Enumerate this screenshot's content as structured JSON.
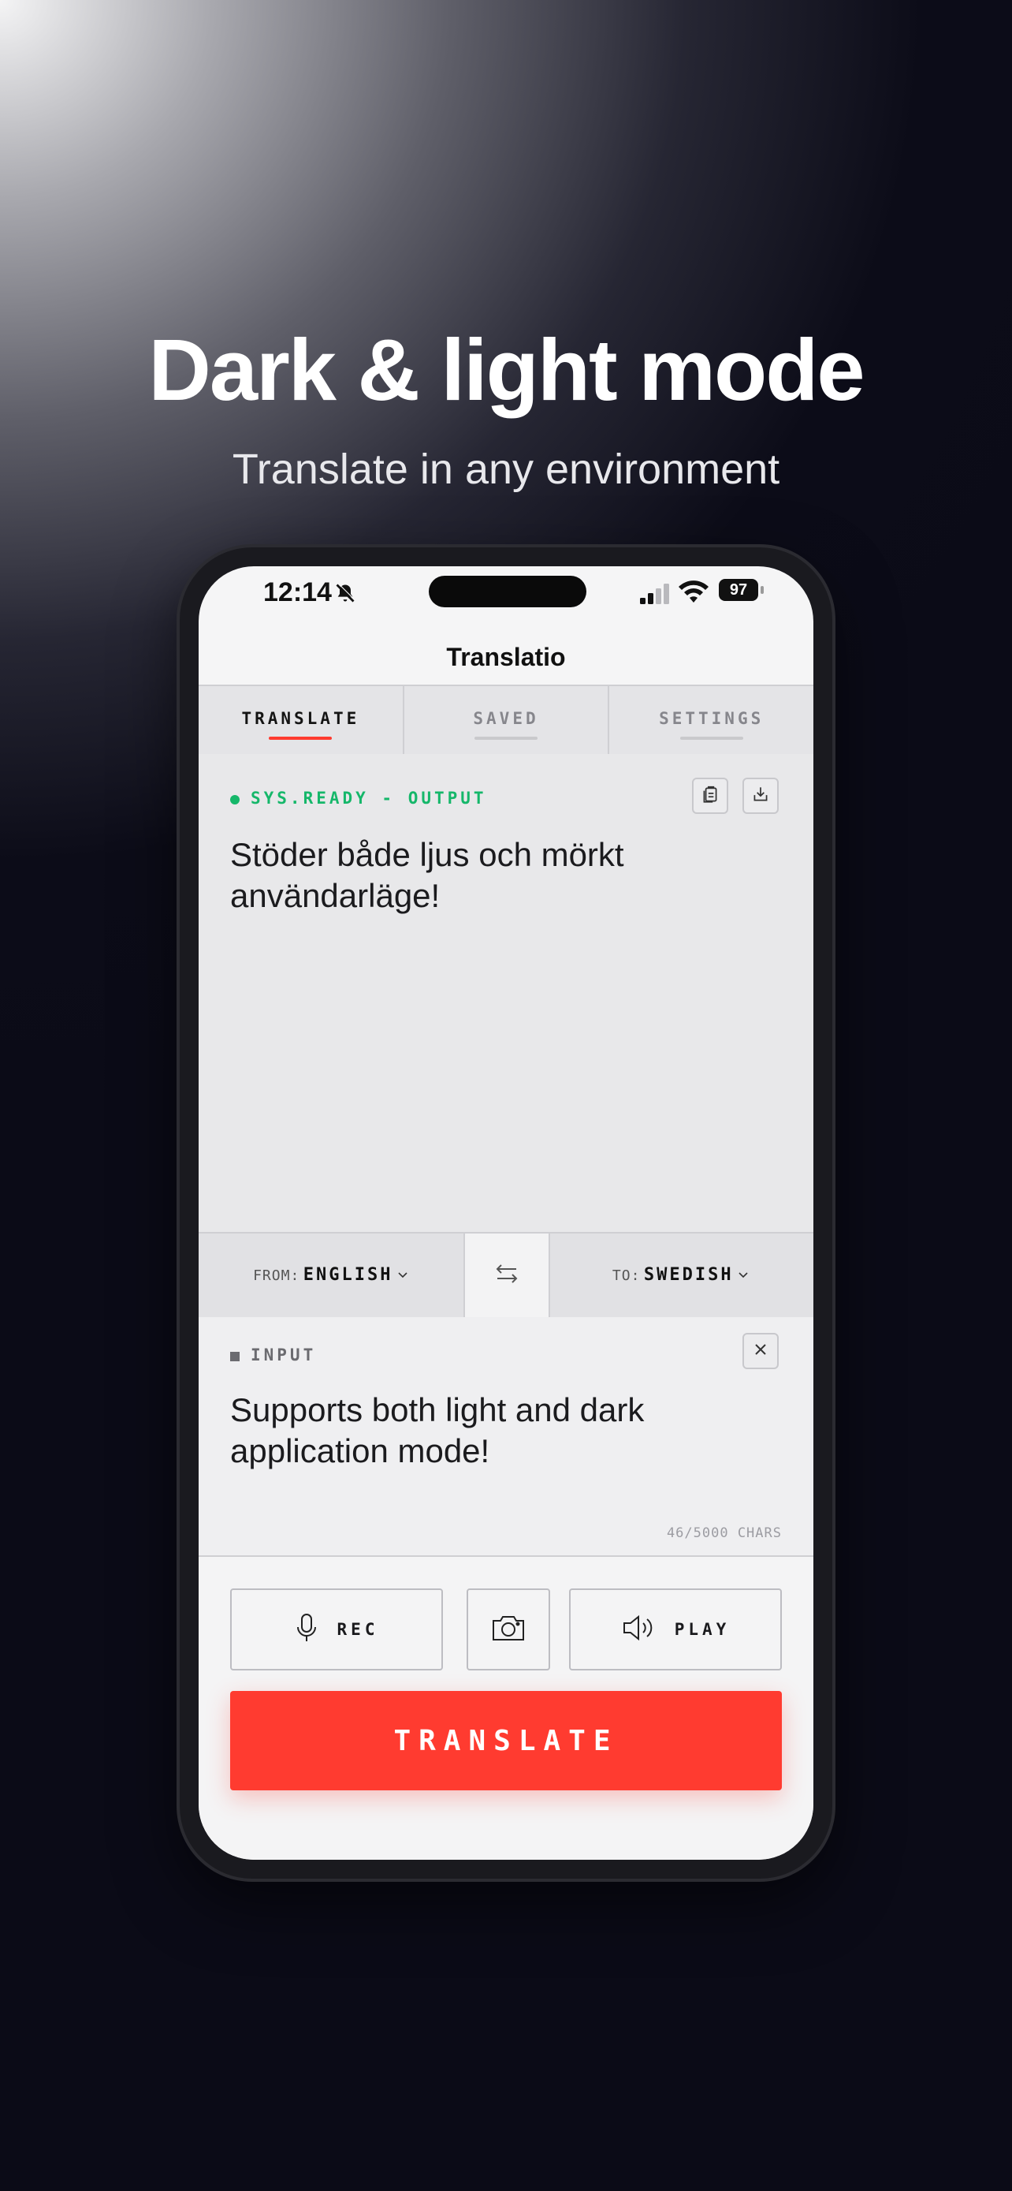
{
  "hero": {
    "title": "Dark & light mode",
    "subtitle": "Translate in any environment"
  },
  "status_bar": {
    "time": "12:14",
    "battery": "97"
  },
  "app": {
    "title": "Translatio"
  },
  "tabs": [
    {
      "label": "TRANSLATE",
      "active": true
    },
    {
      "label": "SAVED",
      "active": false
    },
    {
      "label": "SETTINGS",
      "active": false
    }
  ],
  "output": {
    "status": "SYS.READY - OUTPUT",
    "text": "Stöder både ljus och mörkt användarläge!"
  },
  "languages": {
    "from_prefix": "FROM:",
    "from": "ENGLISH",
    "to_prefix": "TO:",
    "to": "SWEDISH"
  },
  "input": {
    "label": "INPUT",
    "text": "Supports both light and dark application mode!",
    "char_count": "46/5000 CHARS"
  },
  "controls": {
    "rec_label": "REC",
    "play_label": "PLAY",
    "translate_label": "TRANSLATE"
  },
  "colors": {
    "accent": "#ff3b30",
    "ready": "#15b76a"
  }
}
